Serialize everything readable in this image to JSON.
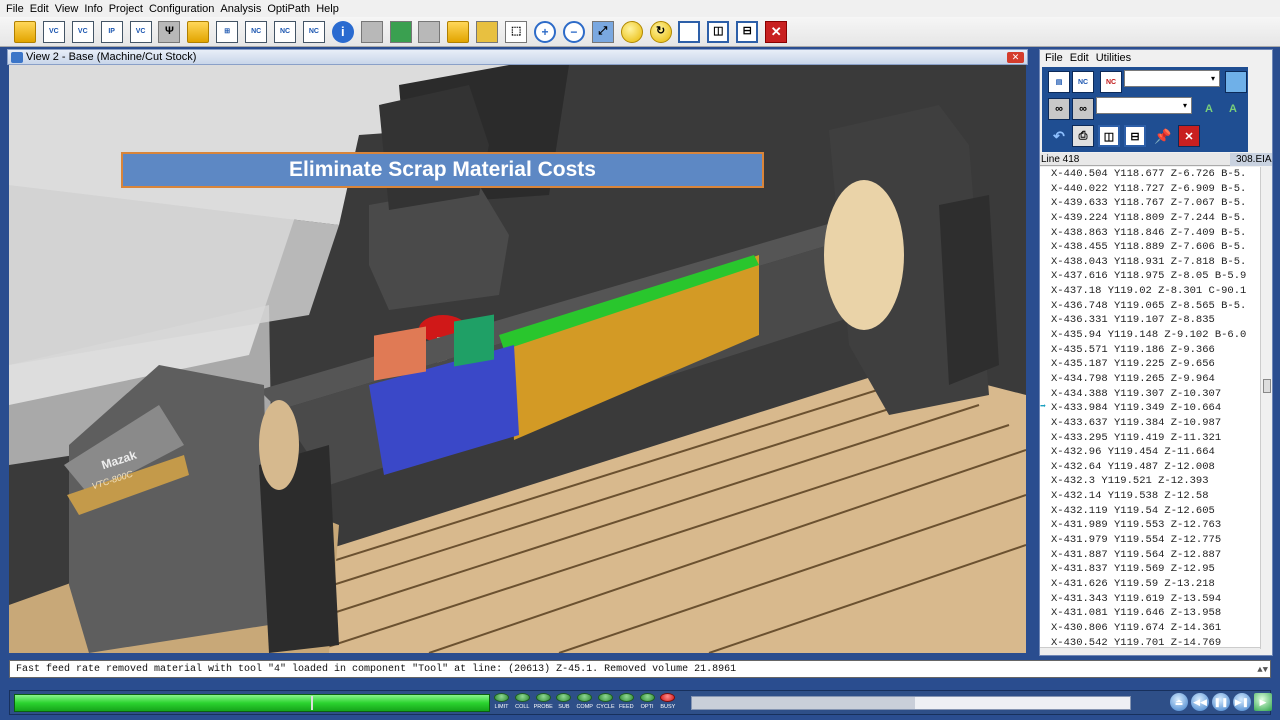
{
  "menu": [
    "File",
    "Edit",
    "View",
    "Info",
    "Project",
    "Configuration",
    "Analysis",
    "OptiPath",
    "Help"
  ],
  "toolbar": [
    {
      "icon": "open-folder-icon",
      "glyph": ""
    },
    {
      "icon": "vc-project-icon",
      "glyph": "VC"
    },
    {
      "icon": "vc-save-icon",
      "glyph": "VC"
    },
    {
      "icon": "ip-project-icon",
      "glyph": "IP"
    },
    {
      "icon": "save-icon",
      "glyph": "VC"
    },
    {
      "icon": "configure-tools-icon",
      "glyph": "Ψ"
    },
    {
      "icon": "folder-check-icon",
      "glyph": ""
    },
    {
      "icon": "component-tree-icon",
      "glyph": "⊞"
    },
    {
      "icon": "nc-program-icon",
      "glyph": "NC"
    },
    {
      "icon": "nc-check-icon",
      "glyph": "NC"
    },
    {
      "icon": "nc-settings-icon",
      "glyph": "NC"
    },
    {
      "icon": "info-icon",
      "glyph": "i"
    },
    {
      "icon": "machine-view-icon",
      "glyph": ""
    },
    {
      "icon": "stock-view-icon",
      "glyph": ""
    },
    {
      "icon": "tool-view-icon",
      "glyph": ""
    },
    {
      "icon": "workpiece-view-icon",
      "glyph": ""
    },
    {
      "icon": "gauge-icon",
      "glyph": ""
    },
    {
      "icon": "select-box-icon",
      "glyph": "⬚"
    },
    {
      "icon": "zoom-in-icon",
      "glyph": "+"
    },
    {
      "icon": "zoom-out-icon",
      "glyph": "−"
    },
    {
      "icon": "fit-view-icon",
      "glyph": "⤢"
    },
    {
      "icon": "light-bulb-icon",
      "glyph": ""
    },
    {
      "icon": "reset-view-icon",
      "glyph": "↻"
    },
    {
      "icon": "single-window-icon",
      "glyph": ""
    },
    {
      "icon": "split-vertical-icon",
      "glyph": "◫"
    },
    {
      "icon": "split-horizontal-icon",
      "glyph": "⊟"
    },
    {
      "icon": "close-icon",
      "glyph": "✕"
    }
  ],
  "viewport": {
    "title": "View 2 - Base (Machine/Cut Stock)",
    "banner": "Eliminate Scrap Material Costs",
    "machine_brand": "Mazak",
    "machine_model": "VTC-800C"
  },
  "right_panel": {
    "menu": [
      "File",
      "Edit",
      "Utilities"
    ],
    "line_label": "Line 418",
    "file_name": "308.EIA",
    "code_lines": [
      "X-440.504 Y118.677 Z-6.726 B-5.",
      "X-440.022 Y118.727 Z-6.909 B-5.",
      "X-439.633 Y118.767 Z-7.067 B-5.",
      "X-439.224 Y118.809 Z-7.244 B-5.",
      "X-438.863 Y118.846 Z-7.409 B-5.",
      "X-438.455 Y118.889 Z-7.606 B-5.",
      "X-438.043 Y118.931 Z-7.818 B-5.",
      "X-437.616 Y118.975 Z-8.05 B-5.9",
      "X-437.18 Y119.02 Z-8.301 C-90.1",
      "X-436.748 Y119.065 Z-8.565 B-5.",
      "X-436.331 Y119.107 Z-8.835",
      "X-435.94 Y119.148 Z-9.102 B-6.0",
      "X-435.571 Y119.186 Z-9.366",
      "X-435.187 Y119.225 Z-9.656",
      "X-434.798 Y119.265 Z-9.964",
      "X-434.388 Y119.307 Z-10.307",
      "X-433.984 Y119.349 Z-10.664",
      "X-433.637 Y119.384 Z-10.987",
      "X-433.295 Y119.419 Z-11.321",
      "X-432.96 Y119.454 Z-11.664",
      "X-432.64 Y119.487 Z-12.008",
      "X-432.3 Y119.521 Z-12.393",
      "X-432.14 Y119.538 Z-12.58",
      "X-432.119 Y119.54 Z-12.605",
      "X-431.989 Y119.553 Z-12.763",
      "X-431.979 Y119.554 Z-12.775",
      "X-431.887 Y119.564 Z-12.887",
      "X-431.837 Y119.569 Z-12.95",
      "X-431.626 Y119.59 Z-13.218",
      "X-431.343 Y119.619 Z-13.594",
      "X-431.081 Y119.646 Z-13.958",
      "X-430.806 Y119.674 Z-14.361",
      "X-430.542 Y119.701 Z-14.769"
    ],
    "current_line_index": 16
  },
  "output_message": "Fast feed rate removed material with tool \"4\" loaded in component \"Tool\" at line: (20613) Z-45.1. Removed volume 21.8961",
  "status_lights": [
    {
      "label": "LIMIT",
      "color": "#3a9a3e"
    },
    {
      "label": "COLL",
      "color": "#3a9a3e"
    },
    {
      "label": "PROBE",
      "color": "#3a9a3e"
    },
    {
      "label": "SUB",
      "color": "#3a9a3e"
    },
    {
      "label": "COMP",
      "color": "#3a9a3e"
    },
    {
      "label": "CYCLE",
      "color": "#3a9a3e"
    },
    {
      "label": "FEED",
      "color": "#3a9a3e"
    },
    {
      "label": "OPTI",
      "color": "#3a9a3e"
    },
    {
      "label": "BUSY",
      "color": "#d01616"
    }
  ],
  "simulation_progress": 1.0,
  "speed_slider_level": 0.51,
  "playback": [
    {
      "icon": "rewind-icon",
      "glyph": "⏏"
    },
    {
      "icon": "step-back-icon",
      "glyph": "◀◀"
    },
    {
      "icon": "pause-icon",
      "glyph": "❚❚"
    },
    {
      "icon": "step-forward-icon",
      "glyph": "▶❚"
    },
    {
      "icon": "play-icon",
      "glyph": "▶"
    }
  ]
}
